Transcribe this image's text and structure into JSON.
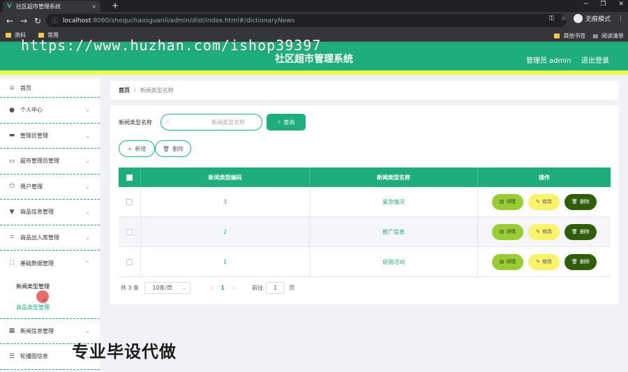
{
  "browser": {
    "tab_title": "社区超市管理系统",
    "tab_favicon": "V",
    "url_host": "localhost",
    "url_path": ":8080/shequchaosguanli/admin/dist/index.html#/dictionaryNews",
    "incognito_label": "无痕模式",
    "bookmarks": [
      "资料",
      "常用"
    ],
    "bookmarks_right": [
      "其他书签",
      "阅读清单"
    ]
  },
  "watermark_top": "https://www.huzhan.com/ishop39397",
  "watermark_bottom": "专业毕设代做",
  "header": {
    "title": "社区超市管理系统",
    "user": "管理员 admin",
    "logout": "退出登录",
    "accent": "#1fad7c",
    "stripe": "#eef94a"
  },
  "sidebar": {
    "items": [
      {
        "label": "首页",
        "icon": "home-icon"
      },
      {
        "label": "个人中心",
        "icon": "user-icon"
      },
      {
        "label": "管理员管理",
        "icon": "admin-icon"
      },
      {
        "label": "超市管理员管理",
        "icon": "card-icon"
      },
      {
        "label": "用户管理",
        "icon": "power-icon"
      },
      {
        "label": "商品信息管理",
        "icon": "goods-icon"
      },
      {
        "label": "商品出入库管理",
        "icon": "crop-icon"
      },
      {
        "label": "基础数据管理",
        "icon": "fullscreen-icon"
      },
      {
        "label": "新闻信息管理",
        "icon": "grid-icon"
      },
      {
        "label": "轮播图信息",
        "icon": "list-icon"
      }
    ],
    "sub_items": [
      "新闻类型管理",
      "商品类型管理"
    ]
  },
  "breadcrumb": {
    "home": "首页",
    "current": "新闻类型名称"
  },
  "search": {
    "label": "新闻类型名称",
    "placeholder": "新闻类型名称",
    "button": "查询"
  },
  "actions": {
    "add": "新增",
    "delete": "删除"
  },
  "table": {
    "headers": [
      "新闻类型编码",
      "新闻类型名称",
      "操作"
    ],
    "rows": [
      {
        "code": "3",
        "name": "紧急情况"
      },
      {
        "code": "2",
        "name": "推广信息"
      },
      {
        "code": "1",
        "name": "促销活动"
      }
    ],
    "ops": {
      "detail": "详情",
      "edit": "修改",
      "delete": "删除"
    }
  },
  "pager": {
    "total": "共 3 条",
    "page_size": "10条/页",
    "current_page": "1",
    "goto_label": "前往",
    "goto_value": "1",
    "page_suffix": "页"
  }
}
